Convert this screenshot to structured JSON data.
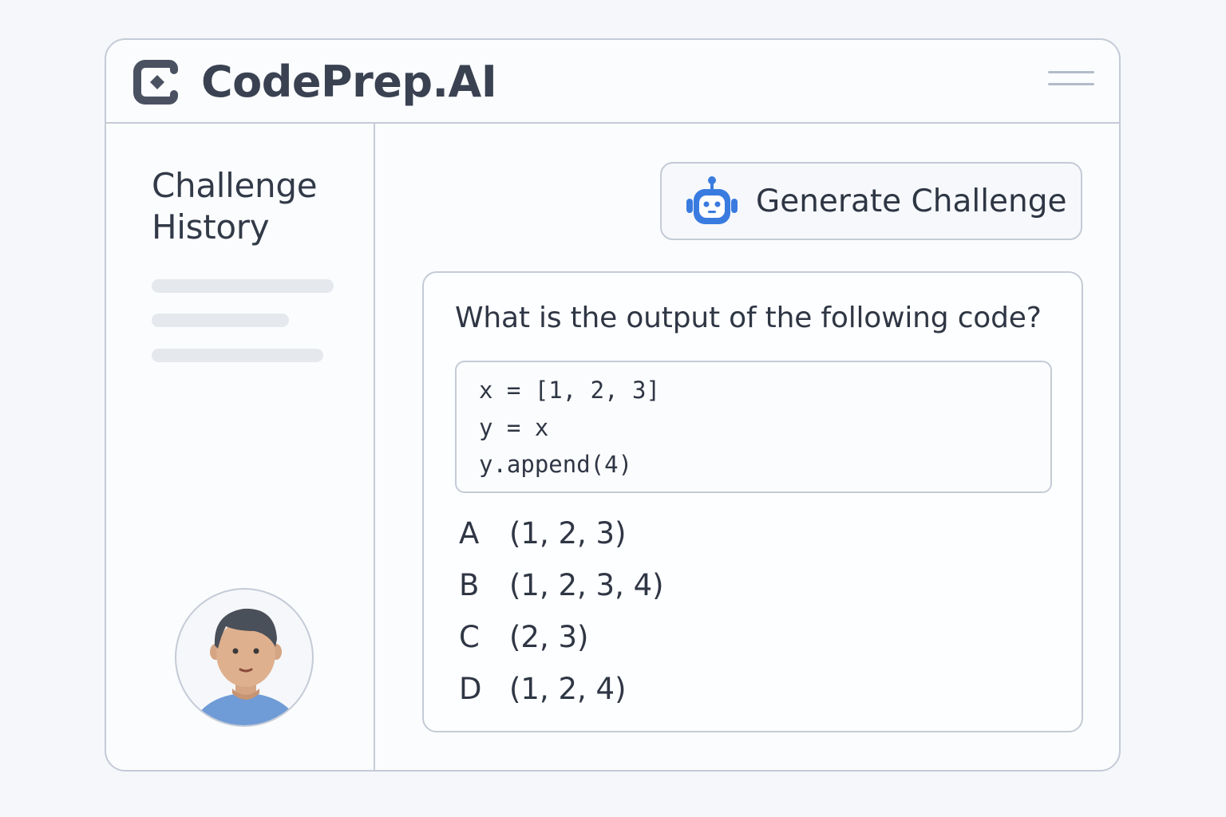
{
  "app": {
    "brand": "CodePrep.AI",
    "logo_icon": "codeprep-logo-icon",
    "menu_icon": "hamburger-menu-icon"
  },
  "sidebar": {
    "title": "Challenge History",
    "history_items": [
      {
        "placeholder": true
      },
      {
        "placeholder": true
      },
      {
        "placeholder": true
      }
    ],
    "avatar_icon": "user-avatar"
  },
  "main": {
    "generate_button": {
      "label": "Generate Challenge",
      "icon": "robot-icon"
    },
    "challenge": {
      "question": "What is the output of the following code?",
      "code_lines": [
        "x = [1, 2, 3]",
        "y = x",
        "y.append(4)"
      ],
      "options": [
        {
          "letter": "A",
          "text": "(1, 2, 3)"
        },
        {
          "letter": "B",
          "text": "(1, 2, 3, 4)"
        },
        {
          "letter": "C",
          "text": "(2, 3)"
        },
        {
          "letter": "D",
          "text": "(1, 2, 4)"
        }
      ]
    }
  },
  "colors": {
    "accent_blue": "#3a7be0",
    "text_dark": "#323a48",
    "border": "#c4cbd6",
    "placeholder_bar": "#e5e8ed"
  }
}
